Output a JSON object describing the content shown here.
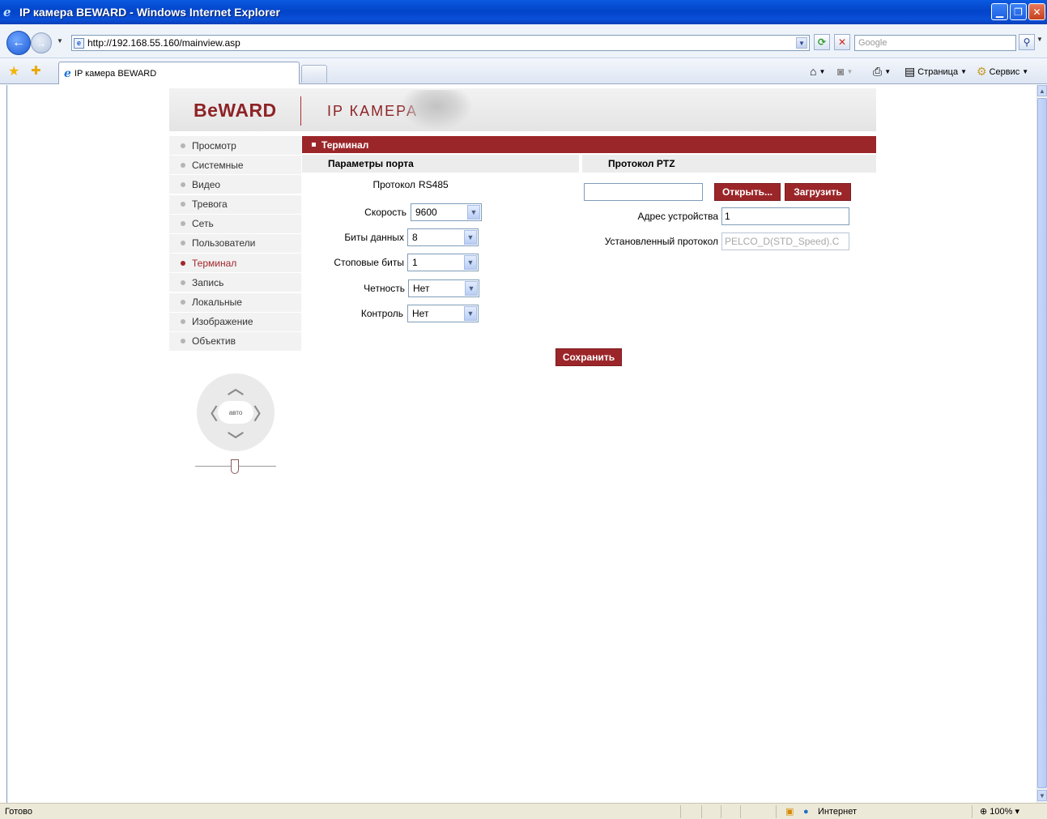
{
  "window": {
    "title": "IP камера BEWARD - Windows Internet Explorer",
    "min_icon": "minimize-icon",
    "max_icon": "restore-icon",
    "close_icon": "close-icon"
  },
  "addressbar": {
    "url": "http://192.168.55.160/mainview.asp",
    "search_placeholder": "Google"
  },
  "tabbar": {
    "tab_title": "IP камера BEWARD",
    "page_label": "Страница",
    "tools_label": "Сервис"
  },
  "banner": {
    "logo": "BeWARD",
    "subtitle": "IP КАМЕРА"
  },
  "menu": {
    "items": [
      {
        "label": "Просмотр",
        "active": false
      },
      {
        "label": "Системные",
        "active": false
      },
      {
        "label": "Видео",
        "active": false
      },
      {
        "label": "Тревога",
        "active": false
      },
      {
        "label": "Сеть",
        "active": false
      },
      {
        "label": "Пользователи",
        "active": false
      },
      {
        "label": "Терминал",
        "active": true
      },
      {
        "label": "Запись",
        "active": false
      },
      {
        "label": "Локальные",
        "active": false
      },
      {
        "label": "Изображение",
        "active": false
      },
      {
        "label": "Объектив",
        "active": false
      }
    ]
  },
  "ptz": {
    "auto_label": "авто"
  },
  "terminal": {
    "title": "Терминал",
    "port_params_title": "Параметры порта",
    "ptz_protocol_title": "Протокол PTZ",
    "protocol_label": "Протокол",
    "protocol_value": "RS485",
    "speed_label": "Скорость",
    "speed_value": "9600",
    "databits_label": "Биты данных",
    "databits_value": "8",
    "stopbits_label": "Стоповые биты",
    "stopbits_value": "1",
    "parity_label": "Четность",
    "parity_value": "Нет",
    "control_label": "Контроль",
    "control_value": "Нет",
    "file_value": "",
    "open_button": "Открыть...",
    "upload_button": "Загрузить",
    "device_address_label": "Адрес устройства",
    "device_address_value": "1",
    "installed_protocol_label": "Установленный протокол",
    "installed_protocol_value": "PELCO_D(STD_Speed).C",
    "save_button": "Сохранить"
  },
  "statusbar": {
    "status": "Готово",
    "zone": "Интернет",
    "zoom": "100%"
  },
  "colors": {
    "accent": "#9b2629",
    "menu_bg": "#f2f2f2",
    "titlebar": "#0a5ae0"
  }
}
